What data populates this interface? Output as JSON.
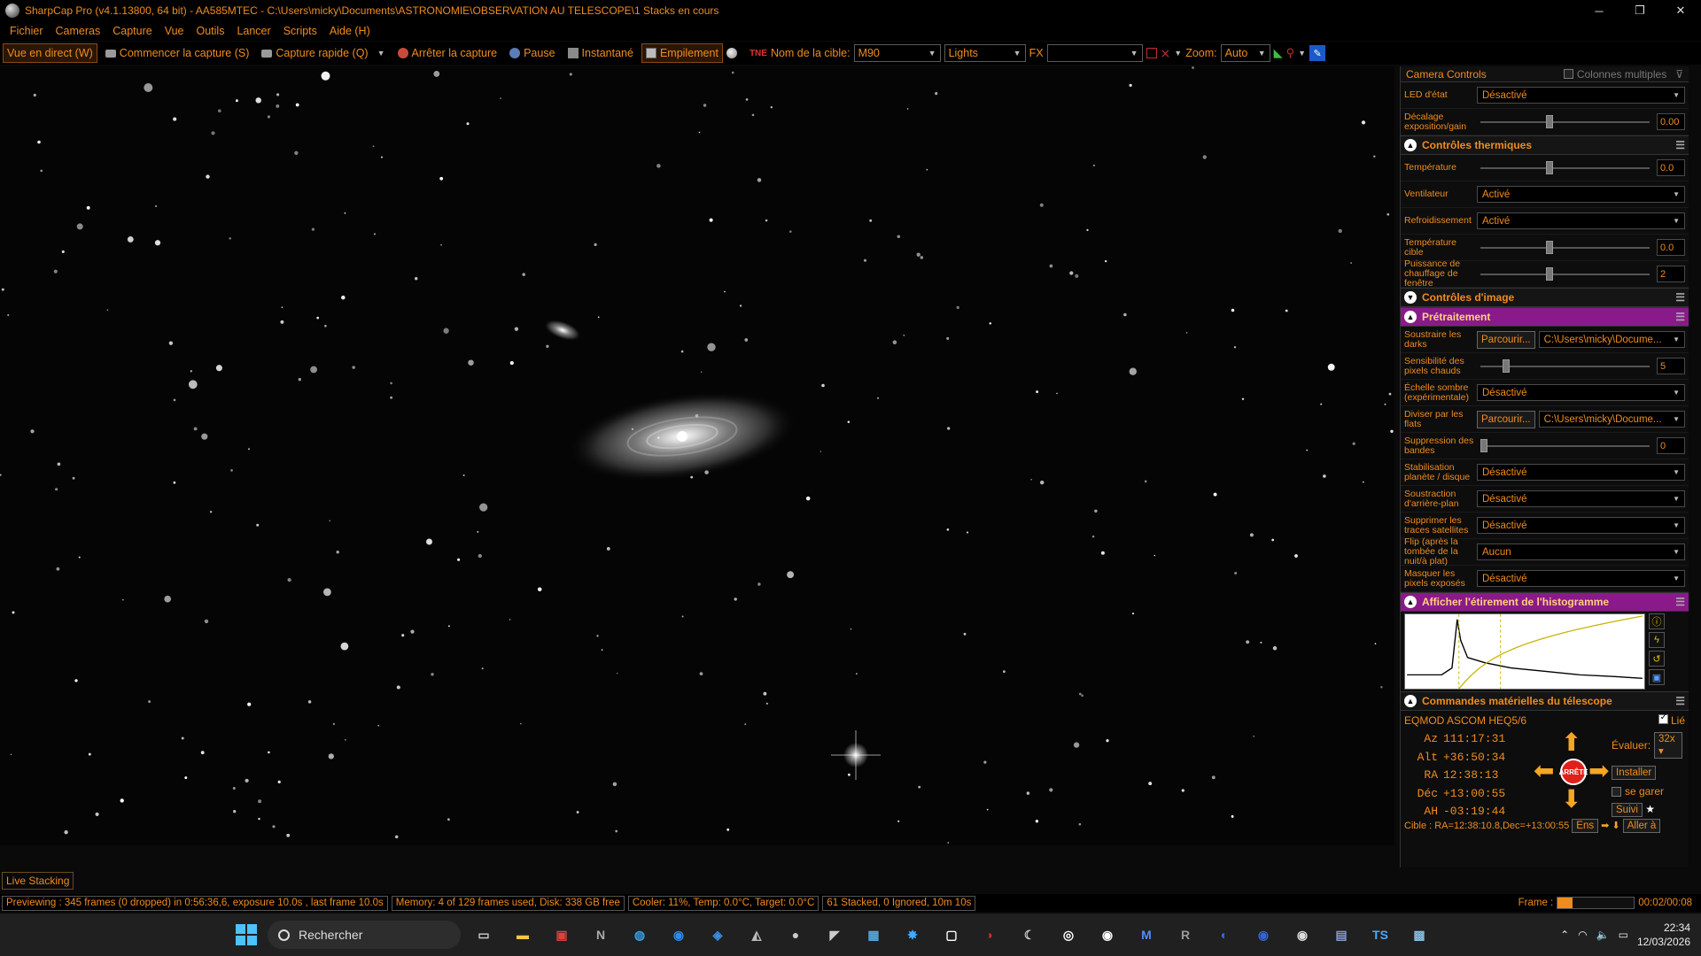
{
  "window": {
    "title": "SharpCap Pro (v4.1.13800, 64 bit) - AA585MTEC - C:\\Users\\micky\\Documents\\ASTRONOMIE\\OBSERVATION AU TELESCOPE\\1 Stacks en cours"
  },
  "menu": [
    "Fichier",
    "Cameras",
    "Capture",
    "Vue",
    "Outils",
    "Lancer",
    "Scripts",
    "Aide (H)"
  ],
  "toolbar": {
    "live_view": "Vue en direct (W)",
    "start_capture": "Commencer la capture (S)",
    "quick_capture": "Capture rapide (Q)",
    "stop_capture": "Arrêter la capture",
    "pause": "Pause",
    "snapshot": "Instantané",
    "stacking": "Empilement",
    "target_label": "Nom de la cible:",
    "target_value": "M90",
    "frame_type": "Lights",
    "fx_label": "FX",
    "fx_value": "",
    "zoom_label": "Zoom:",
    "zoom_value": "Auto"
  },
  "panel": {
    "header": "Camera Controls",
    "multi_columns": "Colonnes multiples",
    "rows_top": [
      {
        "label": "LED d'état",
        "type": "drop",
        "value": "Désactivé"
      },
      {
        "label": "Décalage exposition/gain",
        "type": "slider",
        "value": "0.00",
        "pos": 0.5
      }
    ],
    "thermal_title": "Contrôles thermiques",
    "rows_thermal": [
      {
        "label": "Température",
        "type": "slider",
        "value": "0.0",
        "pos": 0.5
      },
      {
        "label": "Ventilateur",
        "type": "drop",
        "value": "Activé"
      },
      {
        "label": "Refroidissement",
        "type": "drop",
        "value": "Activé"
      },
      {
        "label": "Température cible",
        "type": "slider",
        "value": "0.0",
        "pos": 0.5
      },
      {
        "label": "Puissance de chauffage de fenêtre",
        "type": "slider",
        "value": "2",
        "pos": 0.5
      }
    ],
    "image_title": "Contrôles d'image",
    "preproc_title": "Prétraitement",
    "rows_preproc": [
      {
        "label": "Soustraire les darks",
        "type": "browse",
        "button": "Parcourir...",
        "value": "C:\\Users\\micky\\Docume..."
      },
      {
        "label": "Sensibilité des pixels chauds",
        "type": "slider",
        "value": "5",
        "pos": 0.17
      },
      {
        "label": "Échelle sombre (expérimentale)",
        "type": "drop",
        "value": "Désactivé"
      },
      {
        "label": "Diviser par les flats",
        "type": "browse",
        "button": "Parcourir...",
        "value": "C:\\Users\\micky\\Docume..."
      },
      {
        "label": "Suppression des bandes",
        "type": "slider",
        "value": "0",
        "pos": 0.0
      },
      {
        "label": "Stabilisation planète / disque",
        "type": "drop",
        "value": "Désactivé"
      },
      {
        "label": "Soustraction d'arrière-plan",
        "type": "drop",
        "value": "Désactivé"
      },
      {
        "label": "Supprimer les traces satellites",
        "type": "drop",
        "value": "Désactivé"
      },
      {
        "label": "Flip (après la tombée de la nuit/à plat)",
        "type": "drop",
        "value": "Aucun"
      },
      {
        "label": "Masquer les pixels exposés",
        "type": "drop",
        "value": "Désactivé"
      }
    ],
    "histo_title": "Afficher l'étirement de l'histogramme",
    "scope_title": "Commandes matérielles du télescope",
    "scope": {
      "mount": "EQMOD ASCOM HEQ5/6",
      "linked": "Lié",
      "rate_label": "Évaluer:",
      "rate_value": "32x",
      "install": "Installer",
      "park": "se garer",
      "stop": "ARRÊTE",
      "track": "Suivi",
      "coords": [
        {
          "k": "Az",
          "v": "111:17:31"
        },
        {
          "k": "Alt",
          "v": "+36:50:34"
        },
        {
          "k": "RA",
          "v": "12:38:13"
        },
        {
          "k": "Déc",
          "v": "+13:00:55"
        },
        {
          "k": "AH",
          "v": "-03:19:44"
        }
      ],
      "target": "Cible : RA=12:38:10.8,Dec=+13:00:55",
      "en": "Ens",
      "goto": "Aller à"
    }
  },
  "live_stacking_tab": "Live Stacking",
  "status": {
    "preview": "Previewing : 345 frames (0 dropped) in 0:56:36,6, exposure 10.0s , last frame 10.0s",
    "memory": "Memory: 4 of 129 frames used, Disk: 338 GB free",
    "cooler": "Cooler: 11%, Temp: 0.0°C, Target: 0.0°C",
    "stacked": "61 Stacked, 0 Ignored, 10m 10s",
    "frame_label": "Frame :",
    "frame_progress": 0.2,
    "frame_time": "00:02/00:08"
  },
  "taskbar": {
    "search": "Rechercher",
    "time": "22:34",
    "date": "12/03/2026"
  }
}
